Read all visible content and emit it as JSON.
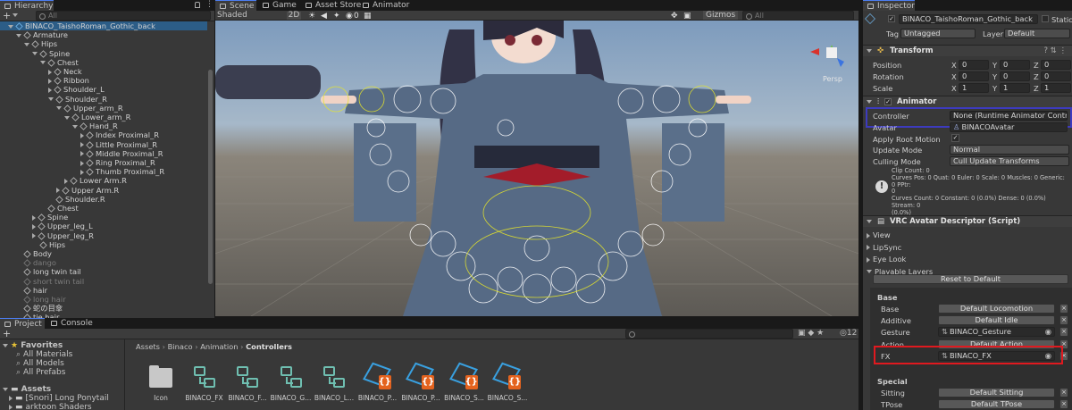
{
  "hierarchy": {
    "tab": "Hierarchy",
    "search_placeholder": "All",
    "add_label": "+",
    "rows": [
      {
        "label": "BINACO_TaishoRoman_Gothic_back",
        "indent": 1,
        "tri": "d",
        "icon": "blue",
        "selected": true
      },
      {
        "label": "Armature",
        "indent": 2,
        "tri": "d"
      },
      {
        "label": "Hips",
        "indent": 3,
        "tri": "d"
      },
      {
        "label": "Spine",
        "indent": 4,
        "tri": "d"
      },
      {
        "label": "Chest",
        "indent": 5,
        "tri": "d"
      },
      {
        "label": "Neck",
        "indent": 6,
        "tri": "r"
      },
      {
        "label": "Ribbon",
        "indent": 6,
        "tri": "r"
      },
      {
        "label": "Shoulder_L",
        "indent": 6,
        "tri": "r"
      },
      {
        "label": "Shoulder_R",
        "indent": 6,
        "tri": "d"
      },
      {
        "label": "Upper_arm_R",
        "indent": 7,
        "tri": "d"
      },
      {
        "label": "Lower_arm_R",
        "indent": 8,
        "tri": "d"
      },
      {
        "label": "Hand_R",
        "indent": 9,
        "tri": "d"
      },
      {
        "label": "Index Proximal_R",
        "indent": 10,
        "tri": "r"
      },
      {
        "label": "Little Proximal_R",
        "indent": 10,
        "tri": "r"
      },
      {
        "label": "Middle Proximal_R",
        "indent": 10,
        "tri": "r"
      },
      {
        "label": "Ring Proximal_R",
        "indent": 10,
        "tri": "r"
      },
      {
        "label": "Thumb Proximal_R",
        "indent": 10,
        "tri": "r"
      },
      {
        "label": "Lower Arm.R",
        "indent": 8,
        "tri": "r"
      },
      {
        "label": "Upper Arm.R",
        "indent": 7,
        "tri": "r"
      },
      {
        "label": "Shoulder.R",
        "indent": 6,
        "tri": "n"
      },
      {
        "label": "Chest",
        "indent": 5,
        "tri": "n"
      },
      {
        "label": "Spine",
        "indent": 4,
        "tri": "r"
      },
      {
        "label": "Upper_leg_L",
        "indent": 4,
        "tri": "r"
      },
      {
        "label": "Upper_leg_R",
        "indent": 4,
        "tri": "r"
      },
      {
        "label": "Hips",
        "indent": 4,
        "tri": "n"
      },
      {
        "label": "Body",
        "indent": 2,
        "tri": "n"
      },
      {
        "label": "dango",
        "indent": 2,
        "tri": "n",
        "dim": true
      },
      {
        "label": "long  twin tail",
        "indent": 2,
        "tri": "n"
      },
      {
        "label": "short twin tail",
        "indent": 2,
        "tri": "n",
        "dim": true
      },
      {
        "label": "hair",
        "indent": 2,
        "tri": "n"
      },
      {
        "label": "long hair",
        "indent": 2,
        "tri": "n",
        "dim": true
      },
      {
        "label": "蛇の目傘",
        "indent": 2,
        "tri": "n"
      },
      {
        "label": "tie hair",
        "indent": 2,
        "tri": "n"
      }
    ]
  },
  "scene": {
    "tabs": [
      "Scene",
      "Game",
      "Asset Store",
      "Animator"
    ],
    "shading": "Shaded",
    "mode_2d": "2D",
    "gizmos": "Gizmos",
    "search_placeholder": "All",
    "layers_count": "0",
    "persp_label": "Persp"
  },
  "inspector": {
    "tab": "Inspector",
    "object_name": "BINACO_TaishoRoman_Gothic_back",
    "static_label": "Static",
    "tag_label": "Tag",
    "tag_value": "Untagged",
    "layer_label": "Layer",
    "layer_value": "Default",
    "transform": {
      "title": "Transform",
      "rows": [
        {
          "label": "Position",
          "x": "0",
          "y": "0",
          "z": "0"
        },
        {
          "label": "Rotation",
          "x": "0",
          "y": "0",
          "z": "0"
        },
        {
          "label": "Scale",
          "x": "1",
          "y": "1",
          "z": "1"
        }
      ]
    },
    "animator": {
      "title": "Animator",
      "controller_label": "Controller",
      "controller_value": "None (Runtime Animator Controller)",
      "avatar_label": "Avatar",
      "avatar_value": "BINACOAvatar",
      "apply_root_label": "Apply Root Motion",
      "update_mode_label": "Update Mode",
      "update_mode_value": "Normal",
      "culling_label": "Culling Mode",
      "culling_value": "Cull Update Transforms",
      "info_lines": [
        "Clip Count: 0",
        "Curves Pos: 0 Quat: 0 Euler: 0 Scale: 0 Muscles: 0 Generic: 0 PPtr:",
        "0",
        "Curves Count: 0 Constant: 0 (0.0%) Dense: 0 (0.0%) Stream: 0",
        "(0.0%)"
      ]
    },
    "descriptor": {
      "title": "VRC Avatar Descriptor (Script)",
      "foldouts": [
        "View",
        "LipSync",
        "Eye Look",
        "Playable Layers"
      ],
      "reset_label": "Reset to Default",
      "base_header": "Base",
      "base_layers": [
        {
          "label": "Base",
          "value": "Default Locomotion",
          "type": "button"
        },
        {
          "label": "Additive",
          "value": "Default Idle",
          "type": "button"
        },
        {
          "label": "Gesture",
          "value": "BINACO_Gesture",
          "type": "field"
        },
        {
          "label": "Action",
          "value": "Default Action",
          "type": "button"
        },
        {
          "label": "FX",
          "value": "BINACO_FX",
          "type": "field"
        }
      ],
      "special_header": "Special",
      "special_layers": [
        {
          "label": "Sitting",
          "value": "Default Sitting"
        },
        {
          "label": "TPose",
          "value": "Default TPose"
        }
      ]
    },
    "highlight_colors": {
      "controller": "#3d3bbf",
      "fx": "#e0191f"
    }
  },
  "project": {
    "tabs": [
      "Project",
      "Console"
    ],
    "add_label": "+",
    "favorites_label": "Favorites",
    "favorites": [
      "All Materials",
      "All Models",
      "All Prefabs"
    ],
    "assets_label": "Assets",
    "asset_folders": [
      "[Snori] Long Ponytail",
      "arktoon Shaders"
    ],
    "breadcrumb": [
      "Assets",
      "Binaco",
      "Animation",
      "Controllers"
    ],
    "count": "12",
    "items": [
      {
        "label": "Icon",
        "kind": "folder"
      },
      {
        "label": "BINACO_FX",
        "kind": "controller"
      },
      {
        "label": "BINACO_F...",
        "kind": "controller"
      },
      {
        "label": "BINACO_G...",
        "kind": "controller"
      },
      {
        "label": "BINACO_L...",
        "kind": "controller"
      },
      {
        "label": "BINACO_P...",
        "kind": "script"
      },
      {
        "label": "BINACO_P...",
        "kind": "script"
      },
      {
        "label": "BINACO_S...",
        "kind": "script"
      },
      {
        "label": "BINACO_S...",
        "kind": "script"
      }
    ]
  },
  "colors": {
    "accent": "#4c7ef3",
    "selection": "#2c5d87",
    "script": "#39a0e0"
  }
}
